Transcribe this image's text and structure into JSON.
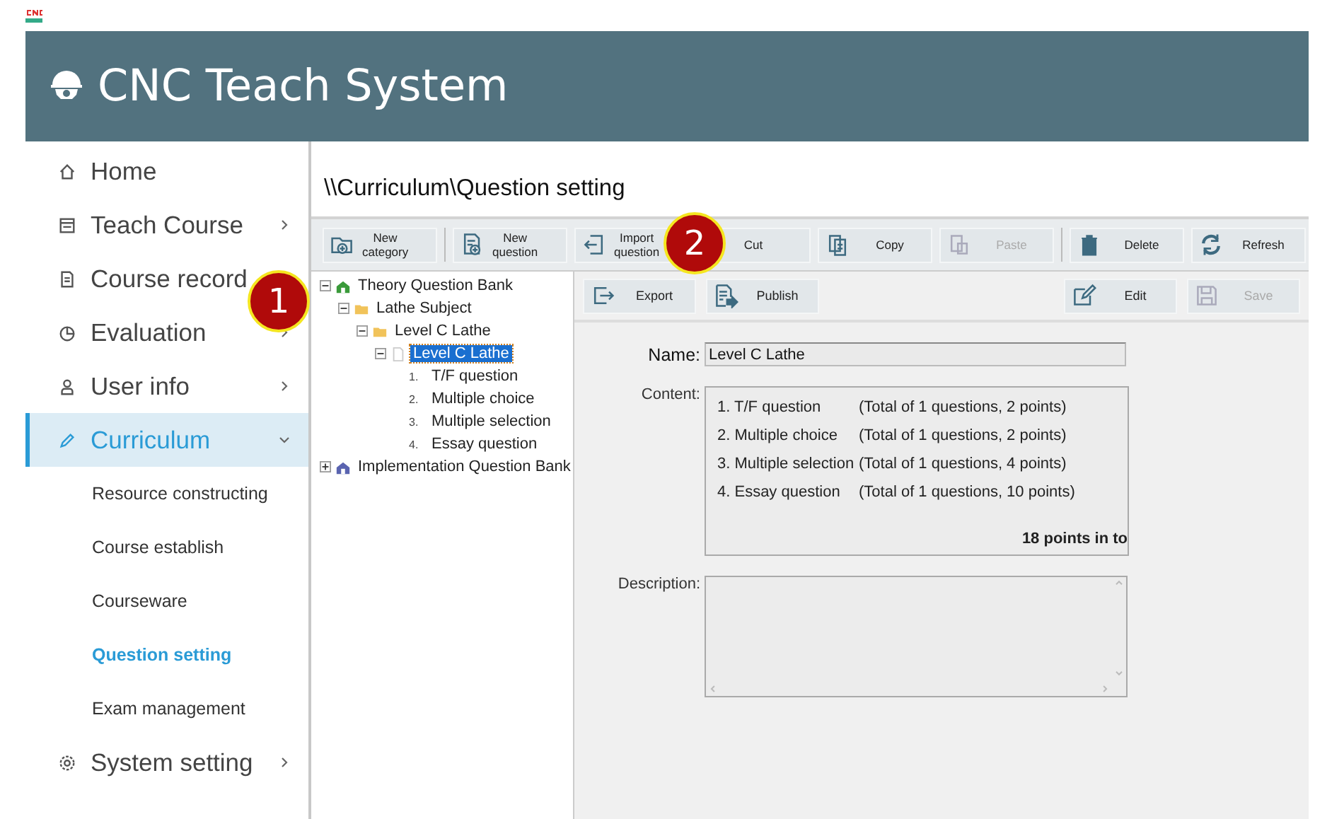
{
  "app": {
    "title": "CNC Teach System"
  },
  "sidebar": {
    "items": [
      {
        "label": "Home",
        "selected": false
      },
      {
        "label": "Teach Course",
        "selected": false,
        "expanded": false
      },
      {
        "label": "Course record",
        "selected": false
      },
      {
        "label": "Evaluation",
        "selected": false,
        "expanded": false
      },
      {
        "label": "User info",
        "selected": false,
        "expanded": false
      },
      {
        "label": "Curriculum",
        "selected": true,
        "expanded": true,
        "children": [
          {
            "label": "Resource constructing",
            "selected": false
          },
          {
            "label": "Course establish",
            "selected": false
          },
          {
            "label": "Courseware",
            "selected": false
          },
          {
            "label": "Question setting",
            "selected": true
          },
          {
            "label": "Exam management",
            "selected": false
          }
        ]
      },
      {
        "label": "System setting",
        "selected": false,
        "expanded": false
      }
    ]
  },
  "breadcrumb": "\\\\Curriculum\\Question setting",
  "toolbar": [
    {
      "lines": [
        "New",
        "category"
      ],
      "disabled": false
    },
    {
      "lines": [
        "New",
        "question"
      ],
      "disabled": false
    },
    {
      "lines": [
        "Import",
        "question"
      ],
      "disabled": false
    },
    {
      "lines": [
        "Cut"
      ],
      "disabled": false
    },
    {
      "lines": [
        "Copy"
      ],
      "disabled": false
    },
    {
      "lines": [
        "Paste"
      ],
      "disabled": true
    },
    {
      "lines": [
        "Delete"
      ],
      "disabled": false
    },
    {
      "lines": [
        "Refresh"
      ],
      "disabled": false
    }
  ],
  "tree": [
    {
      "kind": "bank",
      "label": "Theory Question Bank",
      "selected": false,
      "expanded": true,
      "children": [
        {
          "kind": "folder",
          "label": "Lathe Subject",
          "selected": false,
          "expanded": true,
          "children": [
            {
              "kind": "folder",
              "label": "Level C Lathe",
              "selected": false,
              "expanded": true,
              "children": [
                {
                  "kind": "paper",
                  "label": "Level C Lathe",
                  "selected": true,
                  "expanded": true,
                  "children": [
                    {
                      "kind": "question",
                      "number": "1.",
                      "label": "T/F question",
                      "selected": false
                    },
                    {
                      "kind": "question",
                      "number": "2.",
                      "label": "Multiple choice",
                      "selected": false
                    },
                    {
                      "kind": "question",
                      "number": "3.",
                      "label": "Multiple selection",
                      "selected": false
                    },
                    {
                      "kind": "question",
                      "number": "4.",
                      "label": "Essay question",
                      "selected": false
                    }
                  ]
                }
              ]
            }
          ]
        }
      ]
    },
    {
      "kind": "bank2",
      "label": "Implementation Question Bank",
      "selected": false,
      "expanded": false
    }
  ],
  "detail_toolbar": [
    {
      "label": "Export",
      "disabled": false
    },
    {
      "label": "Publish",
      "disabled": false
    },
    {
      "label": "Edit",
      "disabled": false
    },
    {
      "label": "Save",
      "disabled": true
    }
  ],
  "form": {
    "name_label": "Name:",
    "name_value": "Level C Lathe",
    "content_label": "Content:",
    "content_rows": [
      {
        "item": "1. T/F question",
        "summary": "(Total of 1 questions, 2 points)"
      },
      {
        "item": "2. Multiple choice",
        "summary": "(Total of 1 questions, 2 points)"
      },
      {
        "item": "3. Multiple selection",
        "summary": "(Total of 1 questions, 4 points)"
      },
      {
        "item": "4. Essay question",
        "summary": "(Total of 1 questions, 10 points)"
      }
    ],
    "total": "18 points in to",
    "description_label": "Description:"
  },
  "callouts": [
    "1",
    "2"
  ]
}
